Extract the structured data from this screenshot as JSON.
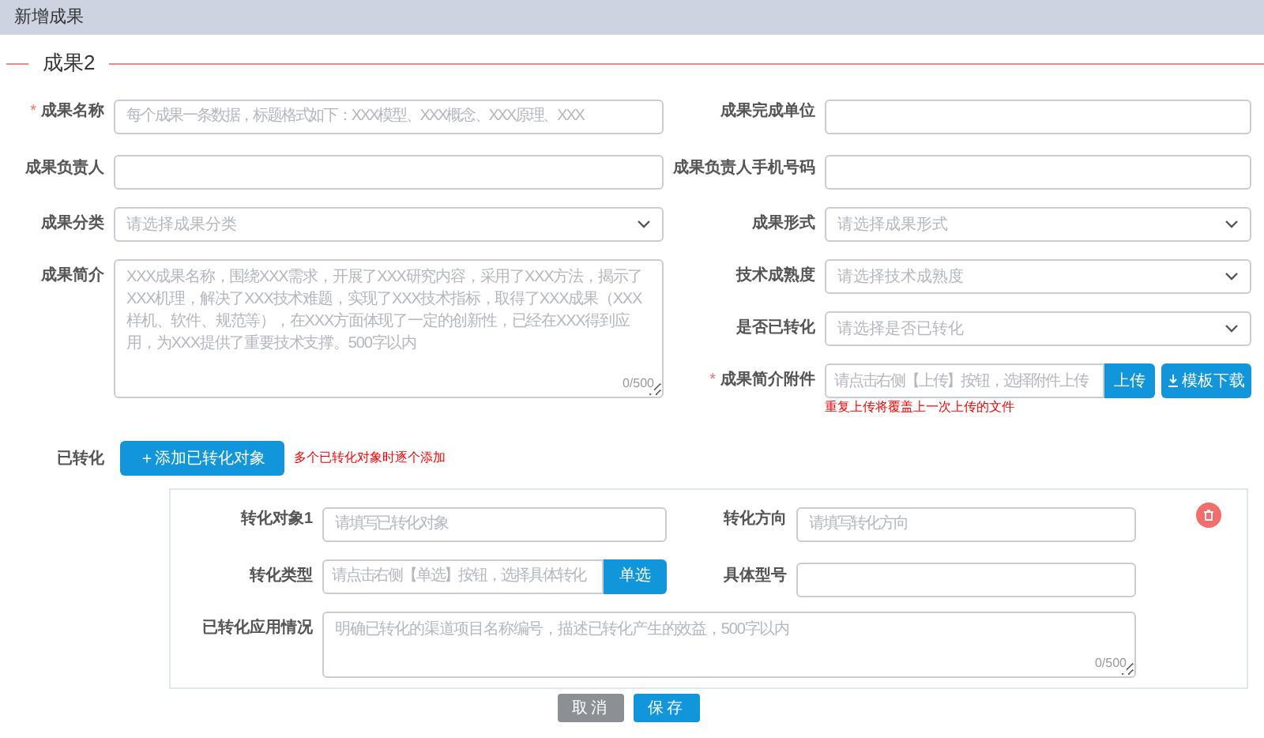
{
  "window": {
    "title": "新增成果"
  },
  "section": {
    "title": "成果2"
  },
  "fields_left": [
    {
      "kind": "input",
      "label": "成果名称",
      "required_mark": "*",
      "placeholder": "每个成果一条数据，标题格式如下：XXX模型、XXX概念、XXX原理、XXX"
    },
    {
      "kind": "input",
      "label": "成果负责人"
    },
    {
      "kind": "select",
      "label": "成果分类",
      "placeholder": "请选择成果分类"
    },
    {
      "kind": "textarea",
      "label": "成果简介",
      "placeholder": "XXX成果名称，围绕XXX需求，开展了XXX研究内容，采用了XXX方法，揭示了XXX机理，解决了XXX技术难题，实现了XXX技术指标，取得了XXX成果（XXX样机、软件、规范等），在XXX方面体现了一定的创新性，已经在XXX得到应用，为XXX提供了重要技术支撑。500字以内",
      "counter": "0/500"
    }
  ],
  "fields_right": [
    {
      "kind": "input",
      "label": "成果完成单位"
    },
    {
      "kind": "input",
      "label": "成果负责人手机号码"
    },
    {
      "kind": "select",
      "label": "成果形式",
      "placeholder": "请选择成果形式"
    },
    {
      "kind": "select",
      "label": "技术成熟度",
      "placeholder": "请选择技术成熟度"
    },
    {
      "kind": "select",
      "label": "是否已转化",
      "placeholder": "请选择是否已转化"
    },
    {
      "kind": "upload",
      "label": "成果简介附件",
      "required_mark": "*",
      "placeholder": "请点击右侧【上传】按钮，选择附件上传",
      "button": "上传",
      "download": "模板下载",
      "note": "重复上传将覆盖上一次上传的文件"
    }
  ],
  "transformed": {
    "label": "已转化",
    "button": "＋添加已转化对象",
    "note": "多个已转化对象时逐个添加"
  },
  "transform_card": {
    "fields_left": [
      {
        "kind": "input",
        "label": "转化对象1",
        "placeholder": "请填写已转化对象"
      },
      {
        "kind": "picker",
        "label": "转化类型",
        "placeholder": "请点击右侧【单选】按钮，选择具体转化",
        "button": "单选"
      }
    ],
    "fields_right": [
      {
        "kind": "input",
        "label": "转化方向",
        "placeholder": "请填写转化方向"
      },
      {
        "kind": "input",
        "label": "具体型号"
      }
    ],
    "application": {
      "kind": "textarea",
      "label": "已转化应用情况",
      "placeholder": "明确已转化的渠道项目名称编号，描述已转化产生的效益，500字以内",
      "counter": "0/500"
    }
  },
  "buttons": [
    {
      "label": "取消",
      "kind": "cancel"
    },
    {
      "label": "保存",
      "kind": "primary"
    }
  ]
}
